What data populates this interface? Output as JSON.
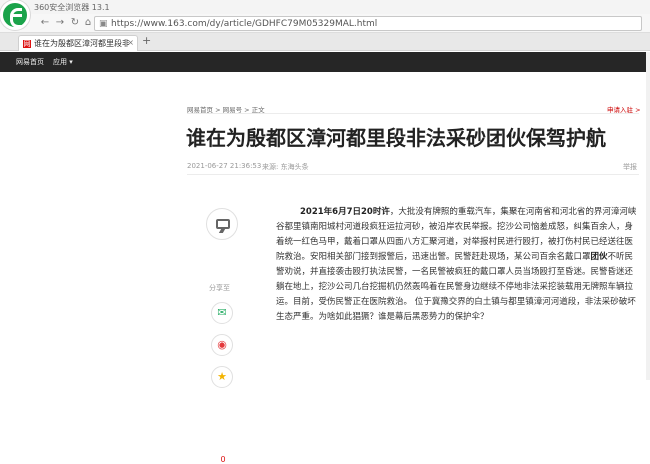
{
  "browser": {
    "title": "360安全浏览器 13.1",
    "url": "https://www.163.com/dy/article/GDHFC79M05329MAL.html",
    "tab_title": "谁在为殷都区漳河都里段非法采砂团伙保驾护航",
    "new_tab": "+",
    "back": "←",
    "forward": "→",
    "refresh": "↻",
    "home": "⌂"
  },
  "site": {
    "nav_home": "网易首页",
    "nav_apps": "应用"
  },
  "article": {
    "breadcrumb": "网易首页 > 网易号 > 正文",
    "apply": "申请入驻 >",
    "title": "谁在为殷都区漳河都里段非法采砂团伙保驾护航",
    "date": "2021-06-27 21:36:53",
    "source": "来源: 东海头条",
    "report": "举报",
    "comment_count": "0",
    "share_label": "分享至",
    "lead": "2021年6月7日20时许",
    "body": "，大批没有牌照的重载汽车，集聚在河南省和河北省的界河漳河峡谷都里镇南阳城村河道段疯狂运拉河砂，被沿岸农民举报。挖沙公司恼羞成怒，纠集百余人，身着统一红色马甲，戴着口罩从四面八方汇聚河道，对举报村民进行殴打，被打伤村民已经送往医院救治。安阳相关部门接到报警后，迅速出警。民警赶赴现场，某公司百余名戴口罩",
    "keyword": "团伙",
    "body2": "不听民警劝说，并直接袭击殴打执法民警，一名民警被疯狂的戴口罩人员当场殴打至昏迷。民警昏迷还躺在地上，挖沙公司几台挖掘机仍然轰鸣着在民警身边继续不停地非法采挖装载用无牌照车辆拉运。目前，受伤民警正在医院救治。 位于冀豫交界的白土镇与都里镇漳河河道段，非法采砂破坏生态严重。为啥如此猖獗？谁是幕后黑恶势力的保护伞？"
  },
  "icons": {
    "comment": "comment-icon",
    "wechat": "wechat-icon",
    "weibo": "weibo-icon",
    "favorite": "star-icon"
  },
  "colors": {
    "brand_red": "#d11",
    "header_bg": "#262626",
    "browser_green": "#1aa34a"
  }
}
